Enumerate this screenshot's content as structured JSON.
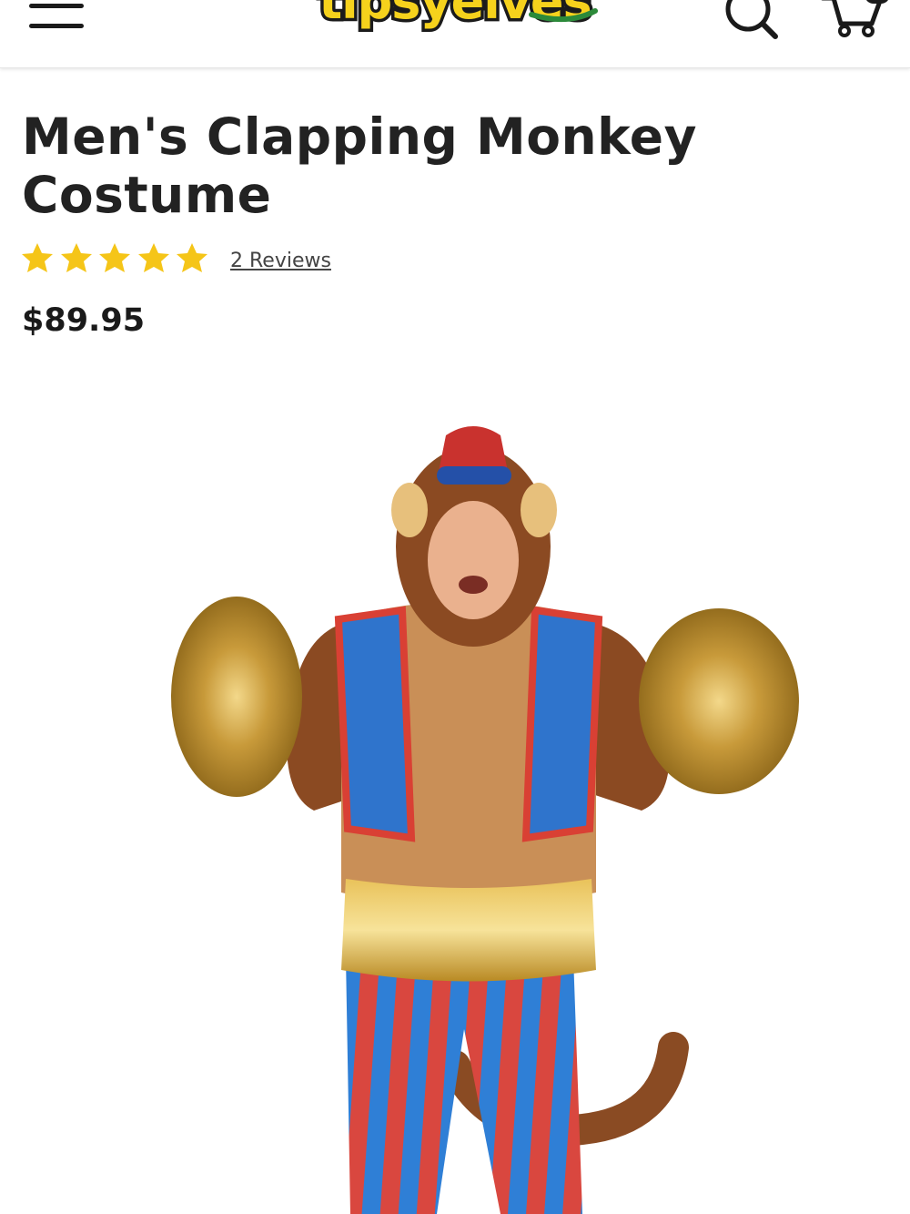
{
  "header": {
    "menu_icon": "hamburger-menu-icon",
    "logo_text": "tipsyelves",
    "search_icon": "search-icon",
    "cart_icon": "cart-icon",
    "logo_colors": {
      "fill": "#f6d21c",
      "outline": "#1b1b1b",
      "accent": "#2c8a3a"
    }
  },
  "product": {
    "title": "Men's Clapping Monkey Costume",
    "rating": {
      "stars": 5,
      "max": 5,
      "star_color": "#f5c518"
    },
    "reviews_label": "2 Reviews",
    "price": "$89.95",
    "image_alt": ""
  }
}
